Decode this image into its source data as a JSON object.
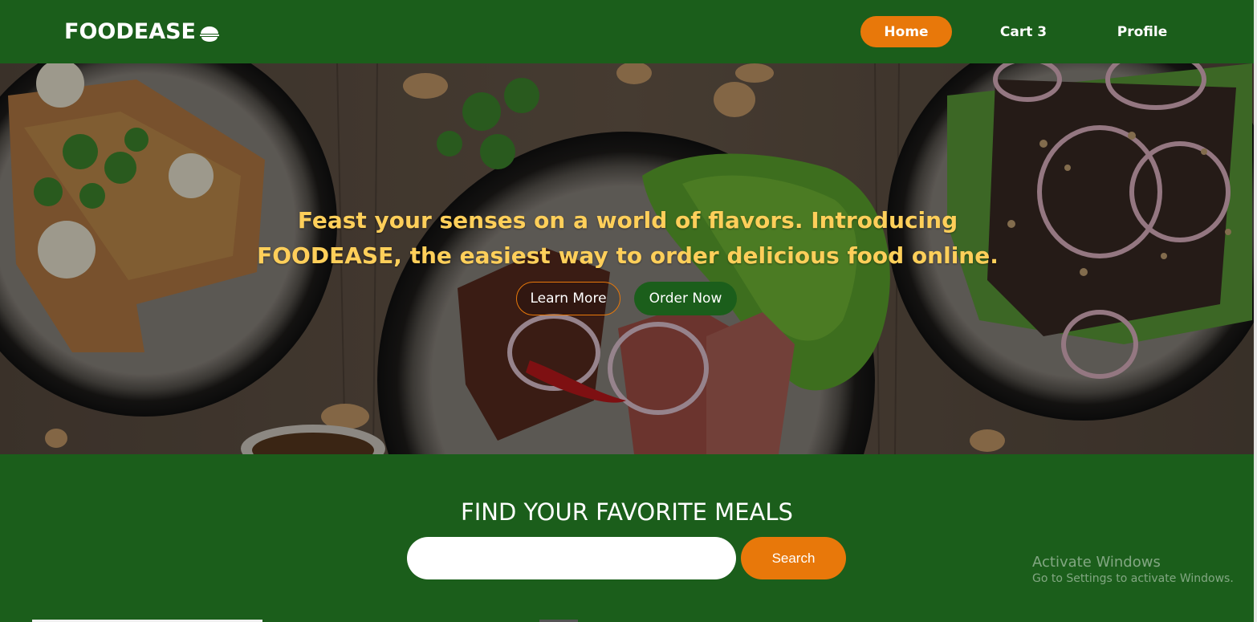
{
  "navbar": {
    "logo_text": "FOODEASE",
    "logo_icon": "bowl-icon",
    "items": [
      {
        "label": "Home",
        "active": true
      },
      {
        "label": "Cart 3",
        "active": false
      },
      {
        "label": "Profile",
        "active": false
      }
    ]
  },
  "hero": {
    "title": "Feast your senses on a world of flavors. Introducing FOODEASE, the easiest way to order delicious food online.",
    "learn_more_label": "Learn More",
    "order_now_label": "Order Now"
  },
  "search": {
    "heading": "FIND YOUR FAVORITE MEALS",
    "input_value": "",
    "button_label": "Search"
  },
  "watermark": {
    "line1": "Activate Windows",
    "line2": "Go to Settings to activate Windows."
  },
  "colors": {
    "brand_green": "#1b5e1b",
    "accent_orange": "#e8780a",
    "hero_text": "#ffcf5a"
  }
}
